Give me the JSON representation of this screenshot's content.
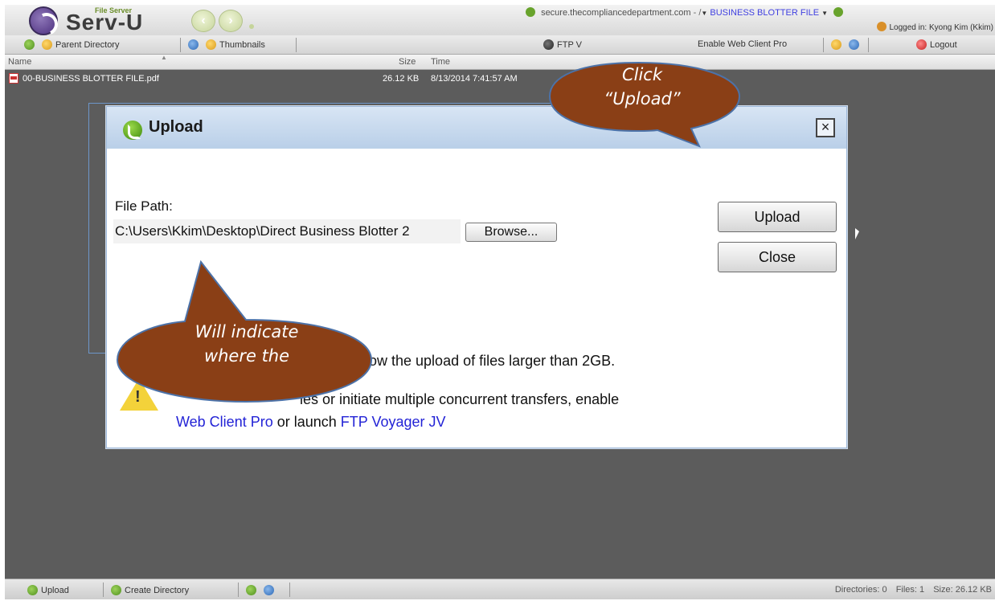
{
  "header": {
    "logo_small": "File Server",
    "logo": "Serv-U",
    "host": "secure.thecompliancedepartment.com",
    "path_sep": "- /",
    "current_folder": "BUSINESS BLOTTER FILE",
    "logged_in": "Logged in: Kyong Kim (Kkim)"
  },
  "toolbar": {
    "parent_directory": "Parent Directory",
    "thumbnails": "Thumbnails",
    "ftp_voyager": "FTP V",
    "enable_web_client_pro": "Enable Web Client Pro",
    "logout": "Logout"
  },
  "columns": {
    "name": "Name",
    "size": "Size",
    "time": "Time"
  },
  "files": [
    {
      "name": "00-BUSINESS BLOTTER FILE.pdf",
      "size": "26.12 KB",
      "time": "8/13/2014 7:41:57 AM"
    }
  ],
  "dialog": {
    "title": "Upload",
    "file_path_label": "File Path:",
    "file_path_value": "C:\\Users\\Kkim\\Desktop\\Direct Business Blotter 2",
    "browse": "Browse...",
    "upload": "Upload",
    "close": "Close",
    "notice_line1": "llow the upload of files larger than 2GB.",
    "notice_line2": "les or initiate multiple concurrent transfers, enable",
    "link_web_client_pro": "Web Client Pro",
    "notice_or": " or launch ",
    "link_ftp_voyager": "FTP Voyager JV"
  },
  "callouts": {
    "upload_hint_line1": "Click",
    "upload_hint_line2": "“Upload”",
    "path_hint_line1": "Will indicate",
    "path_hint_line2": "where the"
  },
  "statusbar": {
    "upload": "Upload",
    "create_directory": "Create Directory",
    "directories": "Directories: 0",
    "files": "Files: 1",
    "size": "Size: 26.12 KB"
  },
  "colors": {
    "callout_fill": "#8a3f16",
    "callout_stroke": "#4c72a8",
    "link": "#2323d6"
  }
}
